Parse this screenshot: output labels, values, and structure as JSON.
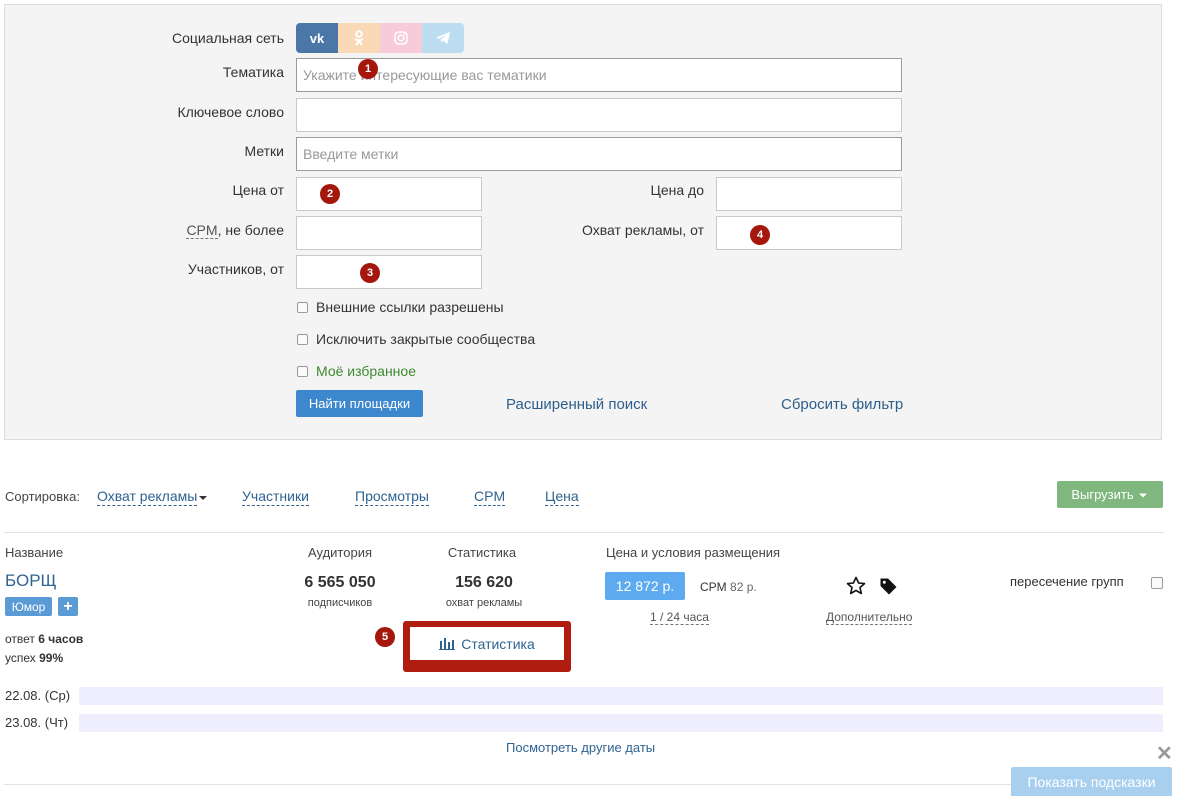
{
  "filter": {
    "social_label": "Социальная сеть",
    "social_buttons": [
      {
        "label": "vk",
        "color": "#4a76a8"
      },
      {
        "label": "ok",
        "color": "#f9d9b6"
      },
      {
        "label": "instagram",
        "color": "#f7cbd9"
      },
      {
        "label": "telegram",
        "color": "#bcdcf0"
      }
    ],
    "topic_label": "Тематика",
    "topic_placeholder": "Укажите интересующие вас тематики",
    "keyword_label": "Ключевое слово",
    "tags_label": "Метки",
    "tags_placeholder": "Введите метки",
    "price_from_label": "Цена от",
    "price_to_label": "Цена до",
    "cpm_label_abbr": "CPM",
    "cpm_label_rest": ", не более",
    "reach_label": "Охват рекламы, от",
    "members_label": "Участников, от",
    "checkbox_external": "Внешние ссылки разрешены",
    "checkbox_closed": "Исключить закрытые сообщества",
    "checkbox_favorites": "Моё избранное",
    "find_button": "Найти площадки",
    "advanced_link": "Расширенный поиск",
    "reset_link": "Сбросить фильтр"
  },
  "badges": [
    "1",
    "2",
    "3",
    "4",
    "5"
  ],
  "sorting": {
    "label": "Сортировка:",
    "options": [
      "Охват рекламы",
      "Участники",
      "Просмотры",
      "CPM",
      "Цена"
    ],
    "export_button": "Выгрузить"
  },
  "columns": {
    "name": "Название",
    "audience": "Аудитория",
    "stats": "Статистика",
    "price": "Цена и условия размещения"
  },
  "result": {
    "title": "БОРЩ",
    "tag": "Юмор",
    "add": "+",
    "response_prefix": "ответ",
    "response_value": "6 часов",
    "success_prefix": "успех",
    "success_value": "99%",
    "audience_value": "6 565 050",
    "audience_unit": "подписчиков",
    "reach_value": "156 620",
    "reach_unit": "охват рекламы",
    "price_value": "12 872 р.",
    "cpm_prefix": "CPM",
    "cpm_value": "82 р.",
    "period": "1 / 24 часа",
    "more_link": "Дополнительно",
    "intersection": "пересечение групп",
    "stats_button": "Статистика"
  },
  "dates": [
    {
      "label": "22.08. (Ср)"
    },
    {
      "label": "23.08. (Чт)"
    }
  ],
  "other_dates_link": "Посмотреть другие даты",
  "hints_button": "Показать подсказки",
  "close_symbol": "✕"
}
